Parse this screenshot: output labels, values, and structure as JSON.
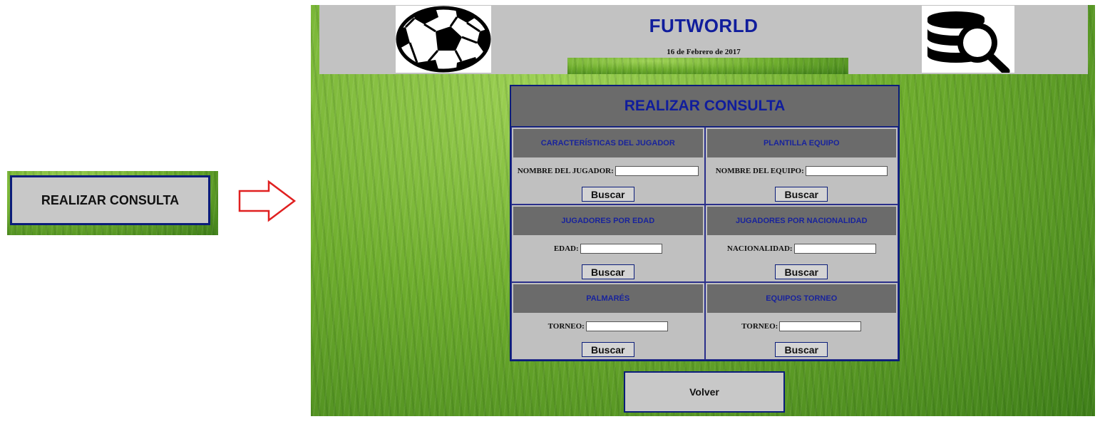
{
  "left_preview": {
    "button_label": "REALIZAR CONSULTA"
  },
  "header": {
    "title": "FUTWORLD",
    "date": "16 de Febrero de 2017",
    "left_logo": "soccer-ball-icon",
    "right_logo": "database-search-icon"
  },
  "panel": {
    "title": "REALIZAR CONSULTA",
    "sections": [
      {
        "title": "CARACTERÍSTICAS DEL JUGADOR",
        "field_label": "NOMBRE DEL JUGADOR:",
        "field_value": "",
        "button": "Buscar"
      },
      {
        "title": "PLANTILLA EQUIPO",
        "field_label": "NOMBRE DEL EQUIPO:",
        "field_value": "",
        "button": "Buscar"
      },
      {
        "title": "JUGADORES POR EDAD",
        "field_label": "EDAD:",
        "field_value": "",
        "button": "Buscar"
      },
      {
        "title": "JUGADORES POR NACIONALIDAD",
        "field_label": "NACIONALIDAD:",
        "field_value": "",
        "button": "Buscar"
      },
      {
        "title": "PALMARÉS",
        "field_label": "TORNEO:",
        "field_value": "",
        "button": "Buscar"
      },
      {
        "title": "EQUIPOS TORNEO",
        "field_label": "TORNEO:",
        "field_value": "",
        "button": "Buscar"
      }
    ]
  },
  "back_button": "Volver",
  "colors": {
    "title_blue": "#101d9c",
    "border_navy": "#0b1d7a",
    "panel_gray": "#c0c0c0",
    "header_dark_gray": "#6b6b6b",
    "grass_green": "#6fae2e",
    "arrow_red": "#e02020"
  }
}
